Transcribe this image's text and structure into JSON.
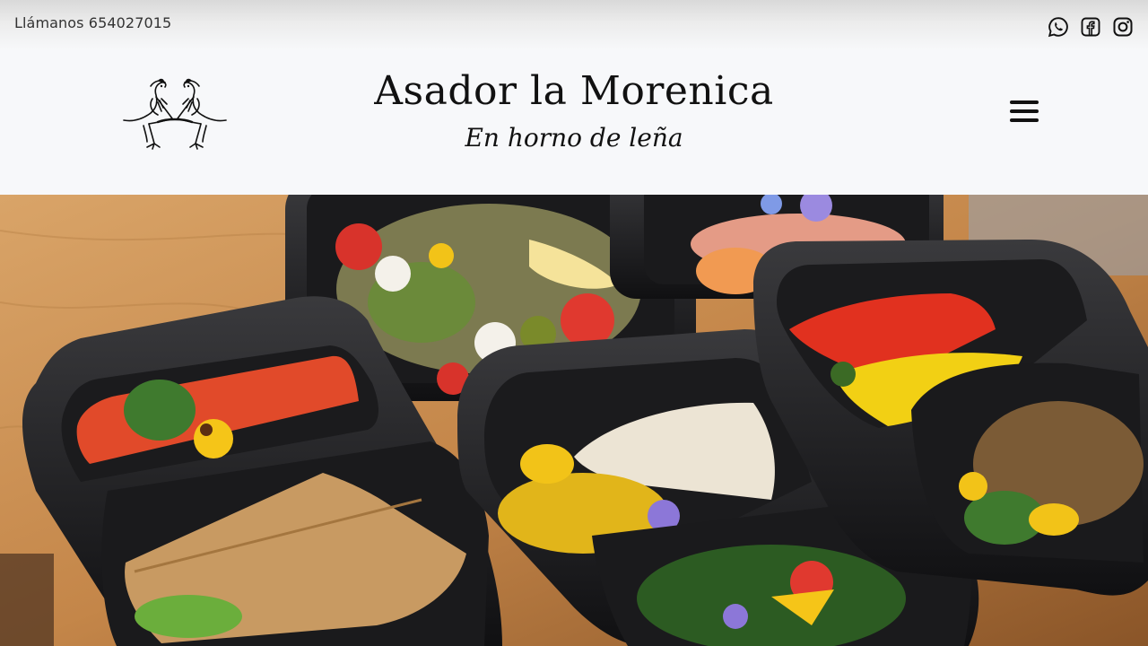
{
  "topbar": {
    "phone_text": "Llámanos 654027015",
    "social": [
      {
        "name": "whatsapp-icon"
      },
      {
        "name": "facebook-icon"
      },
      {
        "name": "instagram-icon"
      }
    ]
  },
  "header": {
    "title": "Asador la Morenica",
    "subtitle": "En horno de leña",
    "logo": "roosters-logo",
    "menu_icon": "hamburger-menu-icon"
  },
  "hero": {
    "image": "meal-prep-containers-photo"
  },
  "colors": {
    "text": "#111111",
    "header_bg": "#f7f8fa",
    "wood": "#c88a4e",
    "tray": "#1c1c1e"
  }
}
